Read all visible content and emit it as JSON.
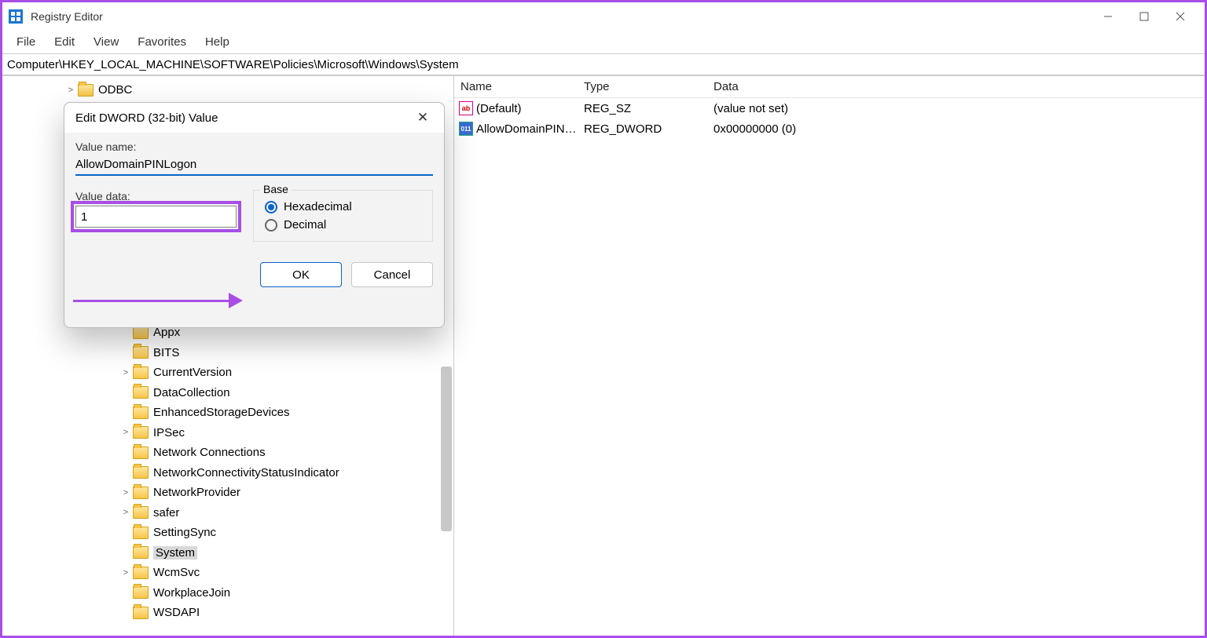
{
  "app": {
    "title": "Registry Editor"
  },
  "menu": [
    "File",
    "Edit",
    "View",
    "Favorites",
    "Help"
  ],
  "address": "Computer\\HKEY_LOCAL_MACHINE\\SOFTWARE\\Policies\\Microsoft\\Windows\\System",
  "columns": {
    "name": "Name",
    "type": "Type",
    "data": "Data"
  },
  "values": [
    {
      "icon": "str",
      "name": "(Default)",
      "type": "REG_SZ",
      "data": "(value not set)"
    },
    {
      "icon": "dw",
      "name": "AllowDomainPIN…",
      "type": "REG_DWORD",
      "data": "0x00000000 (0)"
    }
  ],
  "tree": [
    {
      "indent": 80,
      "chev": ">",
      "label": "ODBC"
    },
    {
      "indent": 150,
      "chev": "",
      "label": "Appx"
    },
    {
      "indent": 150,
      "chev": "",
      "label": "BITS"
    },
    {
      "indent": 150,
      "chev": ">",
      "label": "CurrentVersion"
    },
    {
      "indent": 150,
      "chev": "",
      "label": "DataCollection"
    },
    {
      "indent": 150,
      "chev": "",
      "label": "EnhancedStorageDevices"
    },
    {
      "indent": 150,
      "chev": ">",
      "label": "IPSec"
    },
    {
      "indent": 150,
      "chev": "",
      "label": "Network Connections"
    },
    {
      "indent": 150,
      "chev": "",
      "label": "NetworkConnectivityStatusIndicator"
    },
    {
      "indent": 150,
      "chev": ">",
      "label": "NetworkProvider"
    },
    {
      "indent": 150,
      "chev": ">",
      "label": "safer"
    },
    {
      "indent": 150,
      "chev": "",
      "label": "SettingSync"
    },
    {
      "indent": 150,
      "chev": "",
      "label": "System",
      "selected": true
    },
    {
      "indent": 150,
      "chev": ">",
      "label": "WcmSvc"
    },
    {
      "indent": 150,
      "chev": "",
      "label": "WorkplaceJoin"
    },
    {
      "indent": 150,
      "chev": "",
      "label": "WSDAPI"
    }
  ],
  "dialog": {
    "title": "Edit DWORD (32-bit) Value",
    "value_name_label": "Value name:",
    "value_name": "AllowDomainPINLogon",
    "value_data_label": "Value data:",
    "value_data": "1",
    "base_label": "Base",
    "hex": "Hexadecimal",
    "dec": "Decimal",
    "ok": "OK",
    "cancel": "Cancel"
  }
}
